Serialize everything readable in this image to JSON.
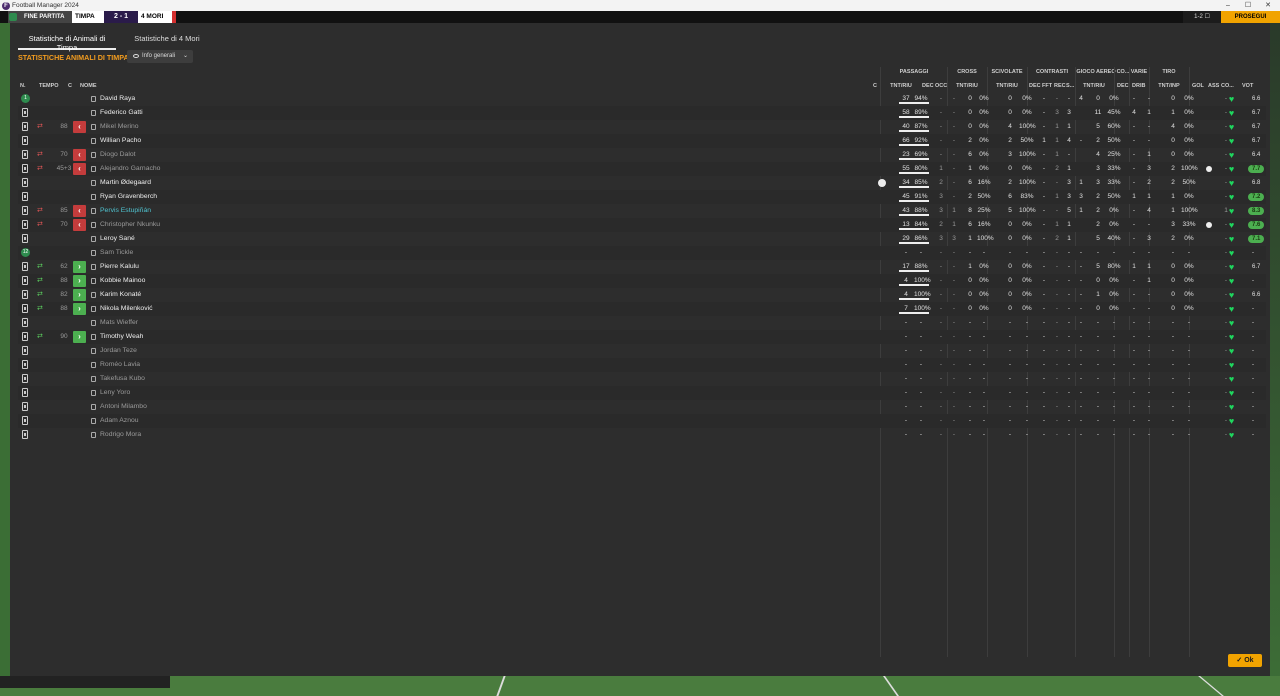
{
  "window": {
    "title": "Football Manager 2024",
    "min": "–",
    "max": "☐",
    "close": "✕"
  },
  "gamebar": {
    "end_label": "FINE PARTITA",
    "home": "TIMPA",
    "score": "2 - 1",
    "away": "4 MORI",
    "time": "1-2 ☐",
    "proceed": "PROSEGUI"
  },
  "tabs": [
    "Statistiche di Animali di Timpa",
    "Statistiche di 4 Mori"
  ],
  "heading": "STATISTICHE ANIMALI DI TIMPA",
  "info_button": "Info generali",
  "groups": {
    "passaggi": "PASSAGGI",
    "cross": "CROSS",
    "scivolate": "SCIVOLATE",
    "contrasti": "CONTRASTI",
    "gioco_aereo": "GIOCO AEREO",
    "co": "CO...",
    "varie": "VARIE",
    "tiro": "TIRO"
  },
  "cols": {
    "n": "N.",
    "tempo": "TEMPO",
    "c": "C",
    "nome": "NOME",
    "c2": "C",
    "pass_tnt": "TNT/RIU",
    "pass_dec": "DEC",
    "pass_occ": "OCC",
    "cross_tnt": "TNT/RIU",
    "sciv_tnt": "TNT/RIU",
    "con_dec": "DEC",
    "con_fft": "FFT",
    "con_rec": "REC",
    "con_s": "S...",
    "aereo_tnt": "TNT/RIU",
    "co_dec": "DEC",
    "drib": "DRIB",
    "tiro_tnt": "TNT/INP",
    "gol": "GOL",
    "ass": "ASS",
    "co2": "CO...",
    "vot": "VOT"
  },
  "ok": "✓ Ok",
  "rows": [
    {
      "num": "1",
      "time": "",
      "sub": "",
      "name": "David Raya",
      "nameStyle": "",
      "p": [
        "37",
        "94%",
        "-",
        "-"
      ],
      "cr": [
        "0",
        "0%"
      ],
      "sc": [
        "0",
        "0%"
      ],
      "ct": [
        "-",
        "-",
        "-",
        "4"
      ],
      "ga": [
        "0",
        "0%"
      ],
      "co": "-",
      "dr": "-",
      "ti": [
        "0",
        "0%"
      ],
      "gol": "",
      "ass": "-",
      "vot": "6.6",
      "good": false,
      "ballF": false,
      "cap": false
    },
    {
      "num": "",
      "time": "",
      "sub": "",
      "name": "Federico Gatti",
      "nameStyle": "",
      "p": [
        "58",
        "89%",
        "-",
        "-"
      ],
      "cr": [
        "0",
        "0%"
      ],
      "sc": [
        "0",
        "0%"
      ],
      "ct": [
        "-",
        "3",
        "3",
        ""
      ],
      "ga": [
        "11",
        "45%"
      ],
      "co": "4",
      "dr": "1",
      "ti": [
        "1",
        "0%"
      ],
      "gol": "",
      "ass": "-",
      "vot": "6.7",
      "good": false,
      "ballF": false,
      "cap": false
    },
    {
      "num": "",
      "time": "88",
      "sub": "out",
      "name": "Mikel Merino",
      "nameStyle": "dim",
      "p": [
        "40",
        "87%",
        "-",
        "-"
      ],
      "cr": [
        "0",
        "0%"
      ],
      "sc": [
        "4",
        "100%"
      ],
      "ct": [
        "-",
        "1",
        "1",
        ""
      ],
      "ga": [
        "5",
        "60%"
      ],
      "co": "-",
      "dr": "-",
      "ti": [
        "4",
        "0%"
      ],
      "gol": "",
      "ass": "-",
      "vot": "6.7",
      "good": false,
      "ballF": false,
      "cap": false
    },
    {
      "num": "",
      "time": "",
      "sub": "",
      "name": "Willian Pacho",
      "nameStyle": "",
      "p": [
        "66",
        "92%",
        "-",
        "-"
      ],
      "cr": [
        "2",
        "0%"
      ],
      "sc": [
        "2",
        "50%"
      ],
      "ct": [
        "1",
        "1",
        "4",
        "-"
      ],
      "ga": [
        "2",
        "50%"
      ],
      "co": "-",
      "dr": "-",
      "ti": [
        "0",
        "0%"
      ],
      "gol": "",
      "ass": "-",
      "vot": "6.7",
      "good": false,
      "ballF": false,
      "cap": false
    },
    {
      "num": "",
      "time": "70",
      "sub": "out",
      "name": "Diogo Dalot",
      "nameStyle": "dim",
      "p": [
        "23",
        "69%",
        "-",
        "-"
      ],
      "cr": [
        "6",
        "0%"
      ],
      "sc": [
        "3",
        "100%"
      ],
      "ct": [
        "-",
        "1",
        "-",
        ""
      ],
      "ga": [
        "4",
        "25%"
      ],
      "co": "-",
      "dr": "1",
      "ti": [
        "0",
        "0%"
      ],
      "gol": "",
      "ass": "-",
      "vot": "6.4",
      "good": false,
      "ballF": false,
      "cap": false
    },
    {
      "num": "",
      "time": "45+3",
      "sub": "out",
      "name": "Alejandro Garnacho",
      "nameStyle": "dim",
      "p": [
        "55",
        "80%",
        "1",
        "-"
      ],
      "cr": [
        "1",
        "0%"
      ],
      "sc": [
        "0",
        "0%"
      ],
      "ct": [
        "-",
        "2",
        "1",
        ""
      ],
      "ga": [
        "3",
        "33%"
      ],
      "co": "-",
      "dr": "3",
      "ti": [
        "2",
        "100%"
      ],
      "gol": "ball",
      "ass": "-",
      "vot": "7.7",
      "good": true,
      "ballF": true,
      "cap": false
    },
    {
      "num": "",
      "time": "",
      "sub": "",
      "name": "Martin Ødegaard",
      "nameStyle": "",
      "p": [
        "34",
        "85%",
        "2",
        "-"
      ],
      "cr": [
        "6",
        "16%"
      ],
      "sc": [
        "2",
        "100%"
      ],
      "ct": [
        "-",
        "-",
        "3",
        "1"
      ],
      "ga": [
        "3",
        "33%"
      ],
      "co": "-",
      "dr": "2",
      "ti": [
        "2",
        "50%"
      ],
      "gol": "",
      "ass": "-",
      "vot": "6.8",
      "good": false,
      "ballF": false,
      "cap": true
    },
    {
      "num": "",
      "time": "",
      "sub": "",
      "name": "Ryan Gravenberch",
      "nameStyle": "",
      "p": [
        "45",
        "91%",
        "3",
        "-"
      ],
      "cr": [
        "2",
        "50%"
      ],
      "sc": [
        "6",
        "83%"
      ],
      "ct": [
        "-",
        "1",
        "3",
        "3"
      ],
      "ga": [
        "2",
        "50%"
      ],
      "co": "1",
      "dr": "1",
      "ti": [
        "1",
        "0%"
      ],
      "gol": "",
      "ass": "-",
      "vot": "7.2",
      "good": true,
      "ballF": false,
      "cap": false
    },
    {
      "num": "",
      "time": "85",
      "sub": "out",
      "name": "Pervis Estupiñán",
      "nameStyle": "cyan",
      "p": [
        "43",
        "88%",
        "3",
        "1"
      ],
      "cr": [
        "8",
        "25%"
      ],
      "sc": [
        "5",
        "100%"
      ],
      "ct": [
        "-",
        "-",
        "5",
        "1"
      ],
      "ga": [
        "2",
        "0%"
      ],
      "co": "-",
      "dr": "4",
      "ti": [
        "1",
        "100%"
      ],
      "gol": "",
      "ass": "1",
      "vot": "8.3",
      "good": true,
      "ballF": false,
      "cap": false
    },
    {
      "num": "",
      "time": "70",
      "sub": "out",
      "name": "Christopher Nkunku",
      "nameStyle": "dim",
      "p": [
        "13",
        "84%",
        "2",
        "1"
      ],
      "cr": [
        "6",
        "16%"
      ],
      "sc": [
        "0",
        "0%"
      ],
      "ct": [
        "-",
        "1",
        "1",
        ""
      ],
      "ga": [
        "2",
        "0%"
      ],
      "co": "-",
      "dr": "-",
      "ti": [
        "3",
        "33%"
      ],
      "gol": "ball",
      "ass": "-",
      "vot": "7.6",
      "good": true,
      "ballF": true,
      "cap": false
    },
    {
      "num": "",
      "time": "",
      "sub": "",
      "name": "Leroy Sané",
      "nameStyle": "",
      "p": [
        "29",
        "86%",
        "3",
        "3"
      ],
      "cr": [
        "1",
        "100%"
      ],
      "sc": [
        "0",
        "0%"
      ],
      "ct": [
        "-",
        "2",
        "1",
        ""
      ],
      "ga": [
        "5",
        "40%"
      ],
      "co": "-",
      "dr": "3",
      "ti": [
        "2",
        "0%"
      ],
      "gol": "",
      "ass": "-",
      "vot": "7.1",
      "good": true,
      "ballF": false,
      "cap": false
    },
    {
      "num": "12",
      "time": "",
      "sub": "",
      "name": "Sam Tickle",
      "nameStyle": "dim",
      "p": [
        "-",
        "-",
        "-",
        "-"
      ],
      "cr": [
        "-",
        "-"
      ],
      "sc": [
        "-",
        "-"
      ],
      "ct": [
        "-",
        "-",
        "-",
        "-"
      ],
      "ga": [
        "-",
        "-"
      ],
      "co": "-",
      "dr": "-",
      "ti": [
        "-",
        "-"
      ],
      "gol": "",
      "ass": "-",
      "vot": "-",
      "good": false,
      "ballF": false,
      "cap": false
    },
    {
      "num": "",
      "time": "62",
      "sub": "in",
      "name": "Pierre Kalulu",
      "nameStyle": "",
      "p": [
        "17",
        "88%",
        "-",
        "-"
      ],
      "cr": [
        "1",
        "0%"
      ],
      "sc": [
        "0",
        "0%"
      ],
      "ct": [
        "-",
        "-",
        "-",
        "-"
      ],
      "ga": [
        "5",
        "80%"
      ],
      "co": "1",
      "dr": "1",
      "ti": [
        "0",
        "0%"
      ],
      "gol": "",
      "ass": "-",
      "vot": "6.7",
      "good": false,
      "ballF": false,
      "cap": false
    },
    {
      "num": "",
      "time": "88",
      "sub": "in",
      "name": "Kobbie Mainoo",
      "nameStyle": "",
      "p": [
        "4",
        "100%",
        "-",
        "-"
      ],
      "cr": [
        "0",
        "0%"
      ],
      "sc": [
        "0",
        "0%"
      ],
      "ct": [
        "-",
        "-",
        "-",
        "-"
      ],
      "ga": [
        "0",
        "0%"
      ],
      "co": "-",
      "dr": "1",
      "ti": [
        "0",
        "0%"
      ],
      "gol": "",
      "ass": "-",
      "vot": "-",
      "good": false,
      "ballF": false,
      "cap": false
    },
    {
      "num": "",
      "time": "82",
      "sub": "in",
      "name": "Karim Konaté",
      "nameStyle": "",
      "p": [
        "4",
        "100%",
        "-",
        "-"
      ],
      "cr": [
        "0",
        "0%"
      ],
      "sc": [
        "0",
        "0%"
      ],
      "ct": [
        "-",
        "-",
        "-",
        "-"
      ],
      "ga": [
        "1",
        "0%"
      ],
      "co": "-",
      "dr": "-",
      "ti": [
        "0",
        "0%"
      ],
      "gol": "",
      "ass": "-",
      "vot": "6.6",
      "good": false,
      "ballF": false,
      "cap": false
    },
    {
      "num": "",
      "time": "88",
      "sub": "in",
      "name": "Nikola Milenković",
      "nameStyle": "",
      "p": [
        "7",
        "100%",
        "-",
        "-"
      ],
      "cr": [
        "0",
        "0%"
      ],
      "sc": [
        "0",
        "0%"
      ],
      "ct": [
        "-",
        "-",
        "-",
        "-"
      ],
      "ga": [
        "0",
        "0%"
      ],
      "co": "-",
      "dr": "-",
      "ti": [
        "0",
        "0%"
      ],
      "gol": "",
      "ass": "-",
      "vot": "-",
      "good": false,
      "ballF": false,
      "cap": false
    },
    {
      "num": "",
      "time": "",
      "sub": "",
      "name": "Mats Wieffer",
      "nameStyle": "dim",
      "p": [
        "-",
        "-",
        "-",
        "-"
      ],
      "cr": [
        "-",
        "-"
      ],
      "sc": [
        "-",
        "-"
      ],
      "ct": [
        "-",
        "-",
        "-",
        "-"
      ],
      "ga": [
        "-",
        "-"
      ],
      "co": "-",
      "dr": "-",
      "ti": [
        "-",
        "-"
      ],
      "gol": "",
      "ass": "-",
      "vot": "-",
      "good": false,
      "ballF": false,
      "cap": false
    },
    {
      "num": "",
      "time": "90",
      "sub": "in",
      "name": "Timothy Weah",
      "nameStyle": "",
      "p": [
        "-",
        "-",
        "-",
        "-"
      ],
      "cr": [
        "-",
        "-"
      ],
      "sc": [
        "-",
        "-"
      ],
      "ct": [
        "-",
        "-",
        "-",
        "-"
      ],
      "ga": [
        "-",
        "-"
      ],
      "co": "-",
      "dr": "-",
      "ti": [
        "-",
        "-"
      ],
      "gol": "",
      "ass": "-",
      "vot": "-",
      "good": false,
      "ballF": false,
      "cap": false
    },
    {
      "num": "",
      "time": "",
      "sub": "",
      "name": "Jordan Teze",
      "nameStyle": "dim",
      "p": [
        "-",
        "-",
        "-",
        "-"
      ],
      "cr": [
        "-",
        "-"
      ],
      "sc": [
        "-",
        "-"
      ],
      "ct": [
        "-",
        "-",
        "-",
        "-"
      ],
      "ga": [
        "-",
        "-"
      ],
      "co": "-",
      "dr": "-",
      "ti": [
        "-",
        "-"
      ],
      "gol": "",
      "ass": "-",
      "vot": "-",
      "good": false,
      "ballF": false,
      "cap": false
    },
    {
      "num": "",
      "time": "",
      "sub": "",
      "name": "Roméo Lavia",
      "nameStyle": "dim",
      "p": [
        "-",
        "-",
        "-",
        "-"
      ],
      "cr": [
        "-",
        "-"
      ],
      "sc": [
        "-",
        "-"
      ],
      "ct": [
        "-",
        "-",
        "-",
        "-"
      ],
      "ga": [
        "-",
        "-"
      ],
      "co": "-",
      "dr": "-",
      "ti": [
        "-",
        "-"
      ],
      "gol": "",
      "ass": "-",
      "vot": "-",
      "good": false,
      "ballF": false,
      "cap": false
    },
    {
      "num": "",
      "time": "",
      "sub": "",
      "name": "Takefusa Kubo",
      "nameStyle": "dim",
      "p": [
        "-",
        "-",
        "-",
        "-"
      ],
      "cr": [
        "-",
        "-"
      ],
      "sc": [
        "-",
        "-"
      ],
      "ct": [
        "-",
        "-",
        "-",
        "-"
      ],
      "ga": [
        "-",
        "-"
      ],
      "co": "-",
      "dr": "-",
      "ti": [
        "-",
        "-"
      ],
      "gol": "",
      "ass": "-",
      "vot": "-",
      "good": false,
      "ballF": false,
      "cap": false
    },
    {
      "num": "",
      "time": "",
      "sub": "",
      "name": "Leny Yoro",
      "nameStyle": "dim",
      "p": [
        "-",
        "-",
        "-",
        "-"
      ],
      "cr": [
        "-",
        "-"
      ],
      "sc": [
        "-",
        "-"
      ],
      "ct": [
        "-",
        "-",
        "-",
        "-"
      ],
      "ga": [
        "-",
        "-"
      ],
      "co": "-",
      "dr": "-",
      "ti": [
        "-",
        "-"
      ],
      "gol": "",
      "ass": "-",
      "vot": "-",
      "good": false,
      "ballF": false,
      "cap": false
    },
    {
      "num": "",
      "time": "",
      "sub": "",
      "name": "Antoni Milambo",
      "nameStyle": "dim",
      "p": [
        "-",
        "-",
        "-",
        "-"
      ],
      "cr": [
        "-",
        "-"
      ],
      "sc": [
        "-",
        "-"
      ],
      "ct": [
        "-",
        "-",
        "-",
        "-"
      ],
      "ga": [
        "-",
        "-"
      ],
      "co": "-",
      "dr": "-",
      "ti": [
        "-",
        "-"
      ],
      "gol": "",
      "ass": "-",
      "vot": "-",
      "good": false,
      "ballF": false,
      "cap": false
    },
    {
      "num": "",
      "time": "",
      "sub": "",
      "name": "Adam Aznou",
      "nameStyle": "dim",
      "p": [
        "-",
        "-",
        "-",
        "-"
      ],
      "cr": [
        "-",
        "-"
      ],
      "sc": [
        "-",
        "-"
      ],
      "ct": [
        "-",
        "-",
        "-",
        "-"
      ],
      "ga": [
        "-",
        "-"
      ],
      "co": "-",
      "dr": "-",
      "ti": [
        "-",
        "-"
      ],
      "gol": "",
      "ass": "-",
      "vot": "-",
      "good": false,
      "ballF": false,
      "cap": false
    },
    {
      "num": "",
      "time": "",
      "sub": "",
      "name": "Rodrigo Mora",
      "nameStyle": "dim",
      "p": [
        "-",
        "-",
        "-",
        "-"
      ],
      "cr": [
        "-",
        "-"
      ],
      "sc": [
        "-",
        "-"
      ],
      "ct": [
        "-",
        "-",
        "-",
        "-"
      ],
      "ga": [
        "-",
        "-"
      ],
      "co": "-",
      "dr": "-",
      "ti": [
        "-",
        "-"
      ],
      "gol": "",
      "ass": "-",
      "vot": "-",
      "good": false,
      "ballF": false,
      "cap": false
    }
  ]
}
